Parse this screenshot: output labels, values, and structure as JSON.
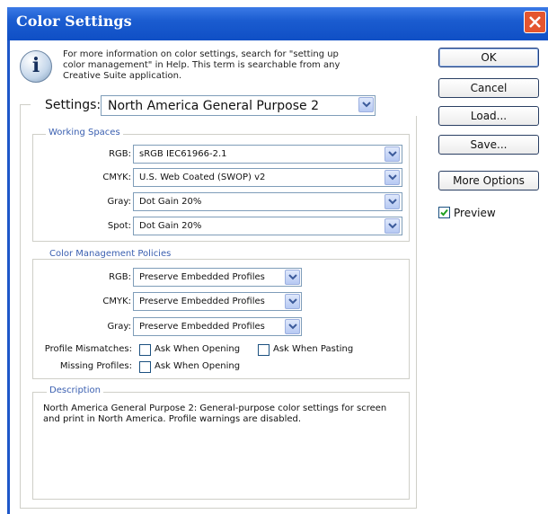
{
  "window": {
    "title": "Color Settings"
  },
  "info": {
    "text_lines": [
      "For more information on color settings, search for \"setting up",
      "color management\" in Help. This term is searchable from any",
      "Creative Suite application."
    ]
  },
  "settings": {
    "label": "Settings:",
    "value": "North America General Purpose 2"
  },
  "working_spaces": {
    "title": "Working Spaces",
    "rows": [
      {
        "label": "RGB:",
        "value": "sRGB IEC61966-2.1"
      },
      {
        "label": "CMYK:",
        "value": "U.S. Web Coated (SWOP) v2"
      },
      {
        "label": "Gray:",
        "value": "Dot Gain 20%"
      },
      {
        "label": "Spot:",
        "value": "Dot Gain 20%"
      }
    ]
  },
  "policies": {
    "title": "Color Management Policies",
    "rows": [
      {
        "label": "RGB:",
        "value": "Preserve Embedded Profiles"
      },
      {
        "label": "CMYK:",
        "value": "Preserve Embedded Profiles"
      },
      {
        "label": "Gray:",
        "value": "Preserve Embedded Profiles"
      }
    ],
    "mismatch_label": "Profile Mismatches:",
    "ask_opening": "Ask When Opening",
    "ask_pasting": "Ask When Pasting",
    "missing_label": "Missing Profiles:",
    "missing_ask_opening": "Ask When Opening"
  },
  "description": {
    "title": "Description",
    "lines": [
      "North America General Purpose 2:  General-purpose color settings for screen",
      "and print in North America. Profile warnings are disabled."
    ]
  },
  "buttons": {
    "ok": "OK",
    "cancel": "Cancel",
    "load": "Load...",
    "save": "Save...",
    "more": "More Options"
  },
  "preview": {
    "label": "Preview",
    "checked": true
  }
}
